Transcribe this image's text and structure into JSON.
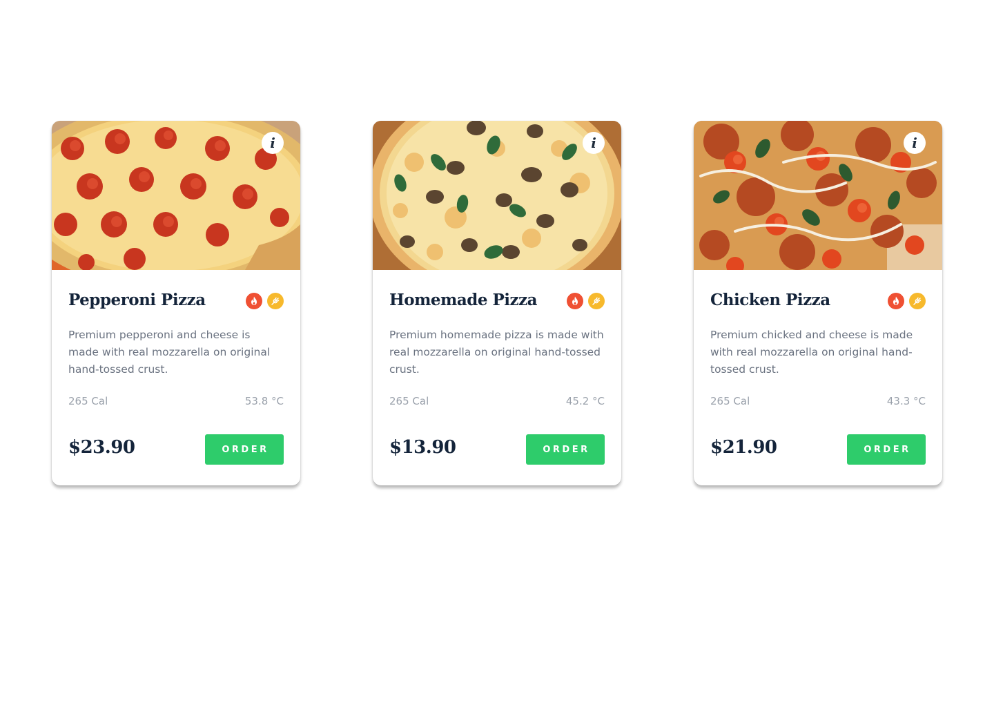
{
  "info_glyph": "i",
  "colors": {
    "accent": "#2ecc6b",
    "heading": "#14243a",
    "text_muted": "#6a7280",
    "meta": "#9aa1ab",
    "spicy_badge": "#ef5033",
    "grain_badge": "#f7b92c"
  },
  "products": [
    {
      "title": "Pepperoni Pizza",
      "description": "Premium pepperoni and cheese is made with real mozzarella on original hand-tossed crust.",
      "calories": "265 Cal",
      "temperature": "53.8 °C",
      "price": "$23.90",
      "order_label": "ORDER",
      "badges": [
        "flame-icon",
        "wheat-icon"
      ]
    },
    {
      "title": "Homemade Pizza",
      "description": "Premium homemade pizza is made with real mozzarella on original hand-tossed crust.",
      "calories": "265 Cal",
      "temperature": "45.2 °C",
      "price": "$13.90",
      "order_label": "ORDER",
      "badges": [
        "flame-icon",
        "wheat-icon"
      ]
    },
    {
      "title": "Chicken Pizza",
      "description": "Premium chicked and cheese is made with real mozzarella on original hand-tossed crust.",
      "calories": "265 Cal",
      "temperature": "43.3 °C",
      "price": "$21.90",
      "order_label": "ORDER",
      "badges": [
        "flame-icon",
        "wheat-icon"
      ]
    }
  ]
}
